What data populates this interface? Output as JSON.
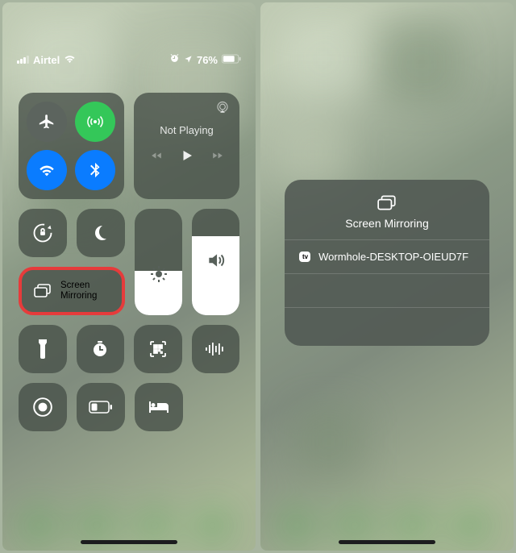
{
  "status": {
    "carrier": "Airtel",
    "battery_pct": "76%"
  },
  "left": {
    "music_title": "Not Playing",
    "mirror_l1": "Screen",
    "mirror_l2": "Mirroring"
  },
  "right": {
    "sheet_title": "Screen Mirroring",
    "device_badge": "tv",
    "device_name": "Wormhole-DESKTOP-OIEUD7F"
  }
}
